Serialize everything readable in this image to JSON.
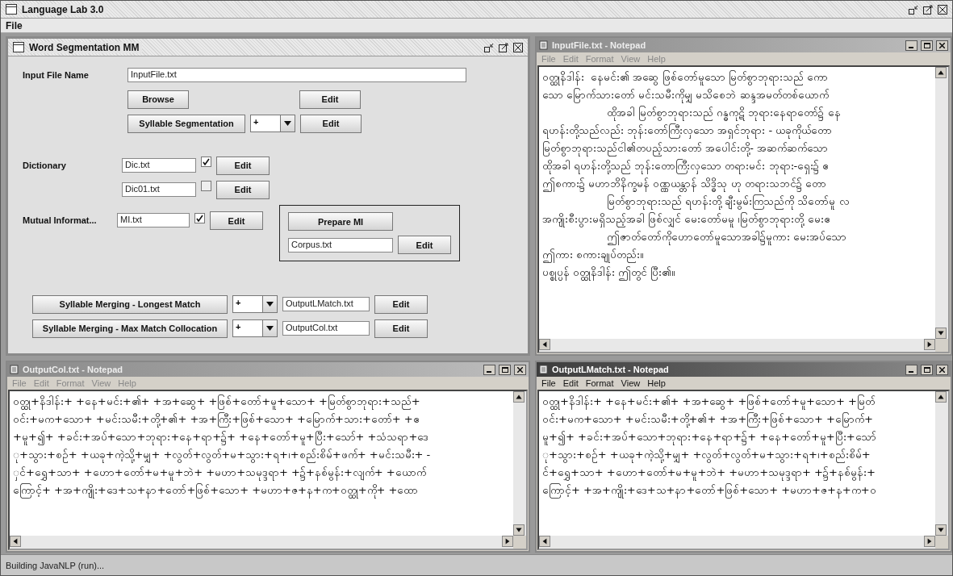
{
  "window": {
    "title": "Language Lab 3.0"
  },
  "menu": [
    "File"
  ],
  "segmentation_frame": {
    "title": "Word Segmentation MM",
    "input_file": {
      "label": "Input File Name",
      "value": "InputFile.txt"
    },
    "browse_button": "Browse",
    "browse_edit": "Edit",
    "syllable_segmentation": {
      "button": "Syllable Segmentation",
      "combo": "+",
      "edit": "Edit"
    },
    "dictionary": {
      "label": "Dictionary",
      "entries": [
        {
          "value": "Dic.txt",
          "checked": true,
          "edit": "Edit"
        },
        {
          "value": "Dic01.txt",
          "checked": false,
          "edit": "Edit"
        }
      ]
    },
    "mutual_information": {
      "label": "Mutual Informat...",
      "value": "MI.txt",
      "checked": true,
      "edit": "Edit",
      "prepare_button": "Prepare MI",
      "corpus": "Corpus.txt",
      "corpus_edit": "Edit"
    },
    "merging": [
      {
        "button": "Syllable Merging - Longest Match",
        "combo": "+",
        "output": "OutputLMatch.txt",
        "edit": "Edit"
      },
      {
        "button": "Syllable Merging - Max Match Collocation",
        "combo": "+",
        "output": "OutputCol.txt",
        "edit": "Edit"
      }
    ]
  },
  "notepads": [
    {
      "title": "InputFile.txt - Notepad",
      "active": false,
      "menu": [
        "File",
        "Edit",
        "Format",
        "View",
        "Help"
      ],
      "lines": [
        {
          "text": "ဝတ္ထုနိဒါန်း  နေမင်း၏ အဆွေ ဖြစ်တော်မူသော မြတ်စွာဘုရားသည် ကော",
          "indented": false
        },
        {
          "text": "သော မြောက်သားတော် မင်းသမီးကိုမျှ မသိစေဘဲ ဆန္ဒအမတ်တစ်ယောက်",
          "indented": false
        },
        {
          "text": "ထိုအခါ မြတ်စွာဘုရားသည် ဂန္ဓကုဋိ ဘုရားနေရာတော်၌ နေ",
          "indented": true
        },
        {
          "text": "ရဟန်းတို့သည်လည်း ဘုန်းတော်ကြီးလှသော အရှင်ဘုရား - ယခုကိုယ်တော",
          "indented": false
        },
        {
          "text": "မြတ်စွာဘုရားသည်ငါ၏တပည့်သားတော် အပေါင်းတို့- အဆက်ဆက်သော",
          "indented": false
        },
        {
          "text": "ထိုအခါ ရဟန်းတို့သည် ဘုန်းတောကြီးလှသော တရားမင်း ဘုရား-ရှေး၌ ဧ",
          "indented": false
        },
        {
          "text": "ဤစကား၌ မဟာဘိနိက္ခမန် ဝဏ္ဏယန္တာန် သိဒ္ဓိသု ဟု တရားသဘင်၌ တော",
          "indented": false
        },
        {
          "text": "မြတ်စွာဘုရားသည် ရဟန်းတို့ ချီးမွမ်းကြသည်ကို သိတော်မူ လ",
          "indented": true
        },
        {
          "text": "အကျိုးစီးပွားမရှိသည့်အခါ ဖြစ်လျှင် မေးတော်မမူ ၊မြတ်စွာဘုရားတို့ မေးဧ",
          "indented": false
        },
        {
          "text": "ဤဇာတ်တော်ကိုဟောတော်မူသောအခါ၌မူကား မေးအပ်သော",
          "indented": true
        },
        {
          "text": "ဤကား စကားချုပ်တည်း။",
          "indented": false
        },
        {
          "text": "ပစ္စုပ္ပန် ဝတ္ထုနိဒါန်း ဤတွင် ပြီး၏။",
          "indented": false
        }
      ]
    },
    {
      "title": "OutputCol.txt - Notepad",
      "active": false,
      "menu": [
        "File",
        "Edit",
        "Format",
        "View",
        "Help"
      ],
      "lines": [
        {
          "text": "ဝတ္ထု+နိဒါန်း+ +နေ+မင်း+၏+ +အ+ဆွေ+ +ဖြစ်+တော်+မူ+သော+ +မြတ်စွာဘုရား+သည်+",
          "indented": false
        },
        {
          "text": "ဝင်း+မက+သော+ +မင်းသမီး+တို့+၏+ +အ+ကြီး+ဖြစ်+သော+ +မြောက်+သား+တော်+ +ဧ",
          "indented": false
        },
        {
          "text": "+မူ+၍+ +ခင်း+အပ်+သော+ဘုရား+နေ+ရာ+၌+ +နေ+တော်+မူ+ပြီး+သော်+ +သံသရာ+ဒေ",
          "indented": false
        },
        {
          "text": "ု+သွား+စဥ်+ +ယခု+ကဲ့သို့+မျှ+ +လွတ်+လွတ်+မ+သွား+ရ+၊+စည်းစိမ်+ဖက်+ +မင်းသမီး+ -",
          "indented": false
        },
        {
          "text": "ှင်+ရွှေ+သာ+ +ဟော+တော်+မ+မူ+ဘဲ+ +မဟာ+သမုဒ္ဒရာ+ +၌+နစ်မွန်း+လျက်+ +ယောက်",
          "indented": false
        },
        {
          "text": "ကြောင့်+ +အ+ကျိုး+ဒေ+သ+နာ+တော်+ဖြစ်+သော+ +မဟာ+ဇ+န+က+ဝတ္ထု+ကို+ +ထော",
          "indented": false
        }
      ]
    },
    {
      "title": "OutputLMatch.txt - Notepad",
      "active": true,
      "menu": [
        "File",
        "Edit",
        "Format",
        "View",
        "Help"
      ],
      "lines": [
        {
          "text": "ဝတ္ထု+နိဒါန်း+ +နေ+မင်း+၏+ +အ+ဆွေ+ +ဖြစ်+တော်+မူ+သော+ +မြတ်",
          "indented": false
        },
        {
          "text": "ဝင်း+မက+သော+ +မင်းသမီး+တို့+၏+ +အ+ကြီး+ဖြစ်+သော+ +မြောက်+",
          "indented": false
        },
        {
          "text": "မူ+၍+ +ခင်း+အပ်+သော+ဘုရား+နေ+ရာ+၌+ +နေ+တော်+မူ+ပြီး+သော်",
          "indented": false
        },
        {
          "text": "ု+သွား+စဥ်+ +ယခု+ကဲ့သို့+မျှ+ +လွတ်+လွတ်+မ+သွား+ရ+၊+စည်းစိမ်+",
          "indented": false
        },
        {
          "text": "င်+ရွှေ+သာ+ +ဟော+တော်+မ+မူ+ဘဲ+ +မဟာ+သမုဒ္ဒရာ+ +၌+နစ်မွန်း+",
          "indented": false
        },
        {
          "text": "ကြောင့်+ +အ+ကျိုး+ဒေ+သ+နာ+တော်+ဖြစ်+သော+ +မဟာ+ဇ+န+က+ဝ",
          "indented": false
        }
      ]
    }
  ],
  "status_bar": "Building JavaNLP (run)..."
}
